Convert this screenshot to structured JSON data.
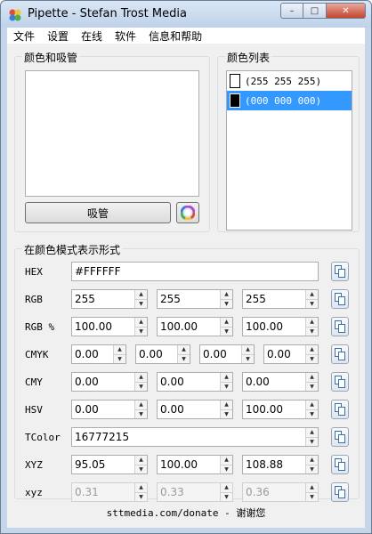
{
  "window": {
    "title": "Pipette - Stefan Trost Media"
  },
  "titlebar": {
    "min": "–",
    "max": "□",
    "close": "✕"
  },
  "menu": [
    "文件",
    "设置",
    "在线",
    "软件",
    "信息和帮助"
  ],
  "picker": {
    "group_title": "颜色和吸管",
    "pipette_button": "吸管"
  },
  "color_list": {
    "group_title": "颜色列表",
    "items": [
      {
        "label": "(255 255 255)",
        "color": "#ffffff",
        "selected": false
      },
      {
        "label": "(000 000 000)",
        "color": "#000000",
        "selected": true
      }
    ]
  },
  "formats": {
    "group_title": "在颜色模式表示形式",
    "hex": {
      "label": "HEX",
      "value": "#FFFFFF"
    },
    "rgb": {
      "label": "RGB",
      "values": [
        "255",
        "255",
        "255"
      ]
    },
    "rgb_pct": {
      "label": "RGB %",
      "values": [
        "100.00",
        "100.00",
        "100.00"
      ]
    },
    "cmyk": {
      "label": "CMYK",
      "values": [
        "0.00",
        "0.00",
        "0.00",
        "0.00"
      ]
    },
    "cmy": {
      "label": "CMY",
      "values": [
        "0.00",
        "0.00",
        "0.00"
      ]
    },
    "hsv": {
      "label": "HSV",
      "values": [
        "0.00",
        "0.00",
        "100.00"
      ]
    },
    "tcolor": {
      "label": "TColor",
      "value": "16777215"
    },
    "xyz": {
      "label": "XYZ",
      "values": [
        "95.05",
        "100.00",
        "108.88"
      ]
    },
    "xyz_small": {
      "label": "xyz",
      "values": [
        "0.31",
        "0.33",
        "0.36"
      ]
    }
  },
  "footer": {
    "donate": "sttmedia.com/donate - 谢谢您"
  },
  "colors": {
    "selection": "#3399ff",
    "frame": "#c6d6ea",
    "close_button": "#c4452f"
  }
}
